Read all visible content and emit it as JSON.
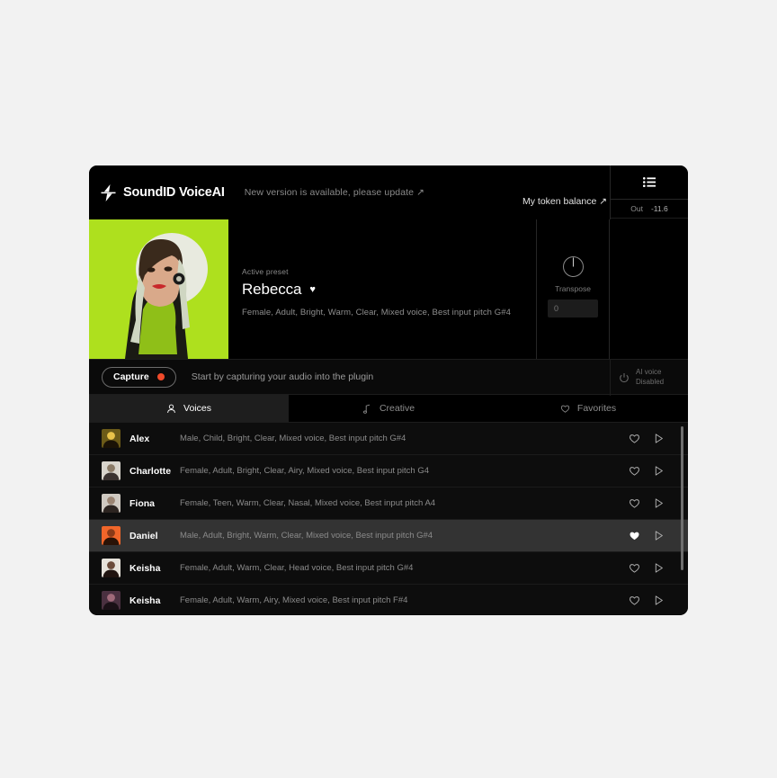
{
  "app": {
    "brand_name": "SoundID VoiceAI",
    "logo_icon": "lightning-bolt-icon",
    "update_notice": "New version is available, please update ↗",
    "token_balance": "My token balance ↗",
    "menu_icon": "list-menu-icon"
  },
  "meter": {
    "label": "Out",
    "value": "-11.6"
  },
  "hero": {
    "kicker": "Active preset",
    "preset_name": "Rebecca",
    "favorite_icon": "heart-filled-icon",
    "tags": "Female, Adult, Bright, Warm, Clear, Mixed voice, Best input pitch  G#4"
  },
  "transpose": {
    "label": "Transpose",
    "value": "0",
    "knob_icon": "knob-icon"
  },
  "capture": {
    "button_label": "Capture",
    "record_icon": "record-dot-icon",
    "hint": "Start by capturing your audio into the plugin",
    "record_color": "#f04a2a"
  },
  "ai_voice": {
    "power_icon": "power-icon",
    "line1": "AI voice",
    "line2": "Disabled"
  },
  "tabs": [
    {
      "label": "Voices",
      "icon": "person-icon",
      "active": true
    },
    {
      "label": "Creative",
      "icon": "music-note-icon",
      "active": false
    },
    {
      "label": "Favorites",
      "icon": "heart-outline-icon",
      "active": false
    }
  ],
  "voice_list": {
    "favorite_icon": "heart-outline-icon",
    "favorite_icon_active": "heart-filled-icon",
    "play_icon": "play-triangle-icon",
    "rows": [
      {
        "name": "Alex",
        "tags": "Male, Child, Bright, Clear, Mixed voice, Best input pitch G#4",
        "favorited": false,
        "selected": false,
        "avatar_colors": [
          "#6b5a18",
          "#e8c24a",
          "#1a1206"
        ]
      },
      {
        "name": "Charlotte",
        "tags": "Female, Adult, Bright, Clear, Airy, Mixed voice, Best input pitch  G4",
        "favorited": false,
        "selected": false,
        "avatar_colors": [
          "#d8d4cc",
          "#8a7a66",
          "#3a3230"
        ]
      },
      {
        "name": "Fiona",
        "tags": "Female, Teen, Warm, Clear, Nasal, Mixed voice, Best input pitch  A4",
        "favorited": false,
        "selected": false,
        "avatar_colors": [
          "#cfc9c1",
          "#9a8472",
          "#2c2420"
        ]
      },
      {
        "name": "Daniel",
        "tags": "Male, Adult, Bright, Warm, Clear, Mixed voice, Best input pitch  G#4",
        "favorited": true,
        "selected": true,
        "avatar_colors": [
          "#f0662a",
          "#8a3a18",
          "#2a1206"
        ]
      },
      {
        "name": "Keisha",
        "tags": "Female, Adult, Warm, Clear, Head voice, Best input pitch  G#4",
        "favorited": false,
        "selected": false,
        "avatar_colors": [
          "#e6e2da",
          "#6a4a38",
          "#201410"
        ]
      },
      {
        "name": "Keisha",
        "tags": "Female, Adult, Warm, Airy, Mixed voice, Best input pitch  F#4",
        "favorited": false,
        "selected": false,
        "avatar_colors": [
          "#4a3040",
          "#a06a7a",
          "#1a1016"
        ]
      }
    ]
  }
}
